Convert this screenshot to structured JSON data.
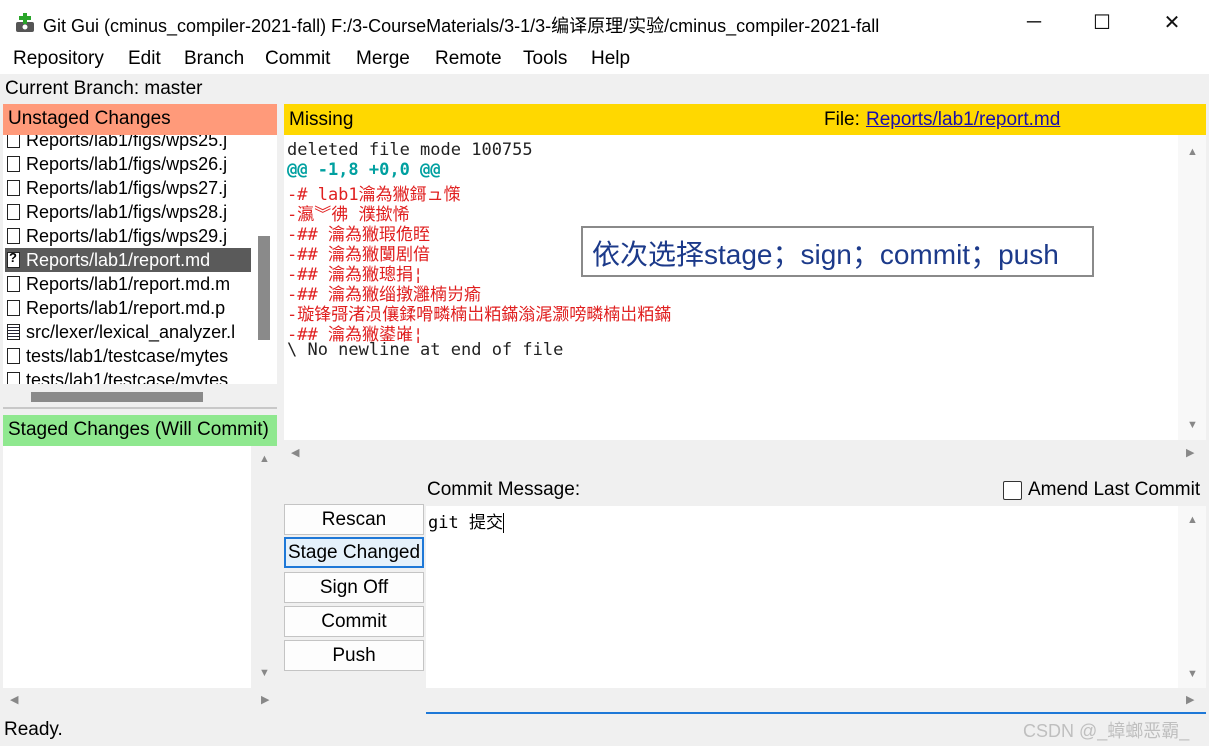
{
  "window": {
    "title": "Git Gui (cminus_compiler-2021-fall) F:/3-CourseMaterials/3-1/3-编译原理/实验/cminus_compiler-2021-fall",
    "app_icon": "git-gui-icon",
    "minimize_glyph": "─",
    "maximize_glyph": "☐",
    "close_glyph": "✕"
  },
  "menu": [
    "Repository",
    "Edit",
    "Branch",
    "Commit",
    "Merge",
    "Remote",
    "Tools",
    "Help"
  ],
  "current_branch": "Current Branch: master",
  "unstaged": {
    "header": "Unstaged Changes",
    "header_color": "#ff9a7a",
    "files": [
      {
        "name": "Reports/lab1/figs/wps25.j",
        "icon": "file-icon",
        "state": "normal"
      },
      {
        "name": "Reports/lab1/figs/wps26.j",
        "icon": "file-icon",
        "state": "normal"
      },
      {
        "name": "Reports/lab1/figs/wps27.j",
        "icon": "file-icon",
        "state": "normal"
      },
      {
        "name": "Reports/lab1/figs/wps28.j",
        "icon": "file-icon",
        "state": "normal"
      },
      {
        "name": "Reports/lab1/figs/wps29.j",
        "icon": "file-icon",
        "state": "normal"
      },
      {
        "name": "Reports/lab1/report.md",
        "icon": "file-missing-icon",
        "state": "selected"
      },
      {
        "name": "Reports/lab1/report.md.m",
        "icon": "file-icon",
        "state": "normal"
      },
      {
        "name": "Reports/lab1/report.md.p",
        "icon": "file-icon",
        "state": "normal"
      },
      {
        "name": "src/lexer/lexical_analyzer.l",
        "icon": "file-modified-icon",
        "state": "normal"
      },
      {
        "name": "tests/lab1/testcase/mytes",
        "icon": "file-icon",
        "state": "normal"
      },
      {
        "name": "tests/lab1/testcase/mytes",
        "icon": "file-icon",
        "state": "normal"
      }
    ]
  },
  "staged": {
    "header": "Staged Changes (Will Commit)",
    "header_color": "#8fe88f"
  },
  "diff": {
    "status": "Missing",
    "file_label": "File:",
    "file_path": "Reports/lab1/report.md",
    "header_color": "#ffd800",
    "lines": [
      {
        "text": "deleted file mode 100755",
        "kind": "normal"
      },
      {
        "text": "@@ -1,8 +0,0 @@",
        "kind": "hunk"
      },
      {
        "text": "-# lab1瀹為獙鎶ュ憡",
        "kind": "del"
      },
      {
        "text": "-瀛︾彿 濮撳悕",
        "kind": "del"
      },
      {
        "text": "-## 瀹為獙瑕佹眰",
        "kind": "del"
      },
      {
        "text": "-## 瀹為獙闅剧偣",
        "kind": "del"
      },
      {
        "text": "-## 瀹為獙璁捐¦",
        "kind": "del"
      },
      {
        "text": "-## 瀹為獙缁撴灉楠岃瘉",
        "kind": "del"
      },
      {
        "text": "-璇锋彁渚涢儴鍒嗗疄楠岀粨鏋滃浘灏嗙疄楠岀粨鏋",
        "kind": "del"
      },
      {
        "text": "-## 瀹為獙鍙嶉¦",
        "kind": "del"
      },
      {
        "text": "\\ No newline at end of file",
        "kind": "normal"
      }
    ]
  },
  "callout": "依次选择stage；sign；commit；push",
  "commit": {
    "label": "Commit Message:",
    "amend_label": "Amend Last Commit",
    "amend_checked": false,
    "message": "git 提交"
  },
  "buttons": [
    {
      "label": "Rescan",
      "name": "rescan-button"
    },
    {
      "label": "Stage Changed",
      "name": "stage-changed-button"
    },
    {
      "label": "Sign Off",
      "name": "sign-off-button"
    },
    {
      "label": "Commit",
      "name": "commit-button"
    },
    {
      "label": "Push",
      "name": "push-button"
    }
  ],
  "status": "Ready.",
  "watermark": "CSDN @_蟑螂恶霸_",
  "scroll_arrows": {
    "up": "▲",
    "down": "▼",
    "left": "◀",
    "right": "▶"
  }
}
